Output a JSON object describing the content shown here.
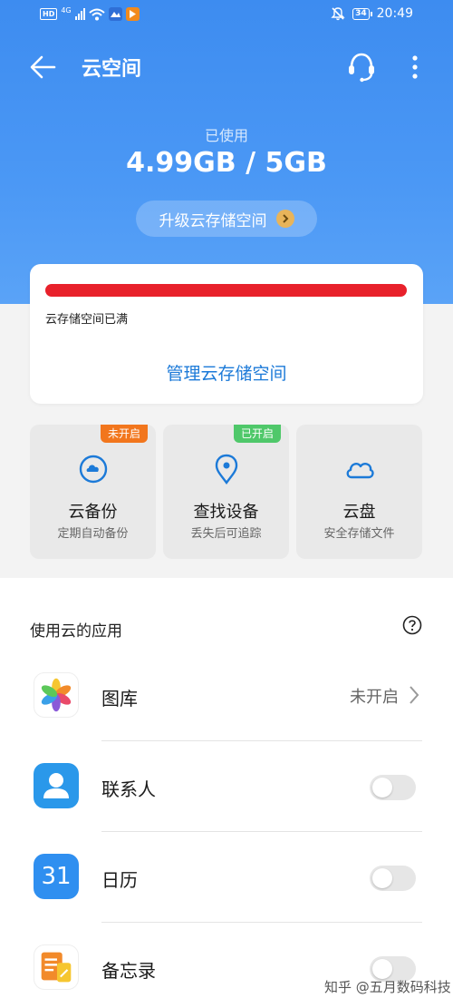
{
  "status_bar": {
    "hd": "HD",
    "network": "4G",
    "time": "20:49",
    "battery": "34"
  },
  "toolbar": {
    "title": "云空间"
  },
  "summary": {
    "used_label": "已使用",
    "used_value": "4.99GB / 5GB",
    "upgrade_label": "升级云存储空间"
  },
  "storage_card": {
    "usage_fraction": 0.998,
    "status_text": "云存储空间已满",
    "manage_label": "管理云存储空间",
    "bar_color": "#e8212b"
  },
  "features": [
    {
      "title": "云备份",
      "subtitle": "定期自动备份",
      "badge": "未开启",
      "icon": "cloud-backup-icon"
    },
    {
      "title": "查找设备",
      "subtitle": "丢失后可追踪",
      "badge": "已开启",
      "icon": "location-pin-icon"
    },
    {
      "title": "云盘",
      "subtitle": "安全存储文件",
      "badge": "",
      "icon": "cloud-icon"
    }
  ],
  "apps": {
    "header": "使用云的应用",
    "items": [
      {
        "name": "图库",
        "status": "未开启",
        "control": "link",
        "icon": "gallery-icon"
      },
      {
        "name": "联系人",
        "control": "toggle",
        "enabled": false,
        "icon": "contacts-icon"
      },
      {
        "name": "日历",
        "icon_text": "31",
        "control": "toggle",
        "enabled": false,
        "icon": "calendar-icon"
      },
      {
        "name": "备忘录",
        "control": "toggle",
        "enabled": false,
        "icon": "notes-icon"
      }
    ]
  },
  "watermark": "知乎 @五月数码科技",
  "colors": {
    "header_blue": "#4b98f5",
    "link_blue": "#1c7ad8",
    "badge_off": "#f2761d",
    "badge_on": "#4fc86a"
  }
}
